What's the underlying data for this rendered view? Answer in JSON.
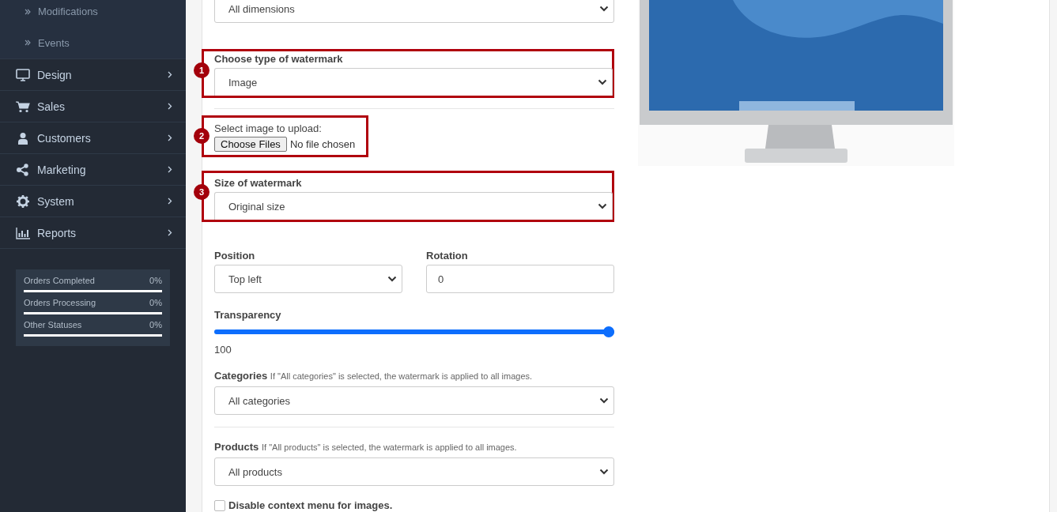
{
  "sidebar": {
    "subitems": [
      {
        "label": "Modifications"
      },
      {
        "label": "Events"
      }
    ],
    "items": [
      {
        "label": "Design",
        "kind": "monitor"
      },
      {
        "label": "Sales",
        "kind": "cart"
      },
      {
        "label": "Customers",
        "kind": "user"
      },
      {
        "label": "Marketing",
        "kind": "share"
      },
      {
        "label": "System",
        "kind": "gear"
      },
      {
        "label": "Reports",
        "kind": "chart"
      }
    ],
    "stats": [
      {
        "label": "Orders Completed",
        "value": "0%"
      },
      {
        "label": "Orders Processing",
        "value": "0%"
      },
      {
        "label": "Other Statuses",
        "value": "0%"
      }
    ]
  },
  "form": {
    "dimensions": {
      "value": "All dimensions"
    },
    "watermark_type": {
      "callout": "1",
      "label": "Choose type of watermark",
      "value": "Image"
    },
    "upload": {
      "callout": "2",
      "label": "Select image to upload:",
      "button": "Choose Files",
      "status": "No file chosen"
    },
    "size": {
      "callout": "3",
      "label": "Size of watermark",
      "value": "Original size"
    },
    "position": {
      "label": "Position",
      "value": "Top left"
    },
    "rotation": {
      "label": "Rotation",
      "value": "0"
    },
    "transparency": {
      "label": "Transparency",
      "level": 1,
      "reading": "100"
    },
    "categories": {
      "label": "Categories",
      "hint": "If \"All categories\" is selected, the watermark is applied to all images.",
      "value": "All categories"
    },
    "products": {
      "label": "Products",
      "hint": "If \"All products\" is selected, the watermark is applied to all images.",
      "value": "All products"
    },
    "context_menu": {
      "label": "Disable context menu for images.",
      "checked": false
    }
  }
}
